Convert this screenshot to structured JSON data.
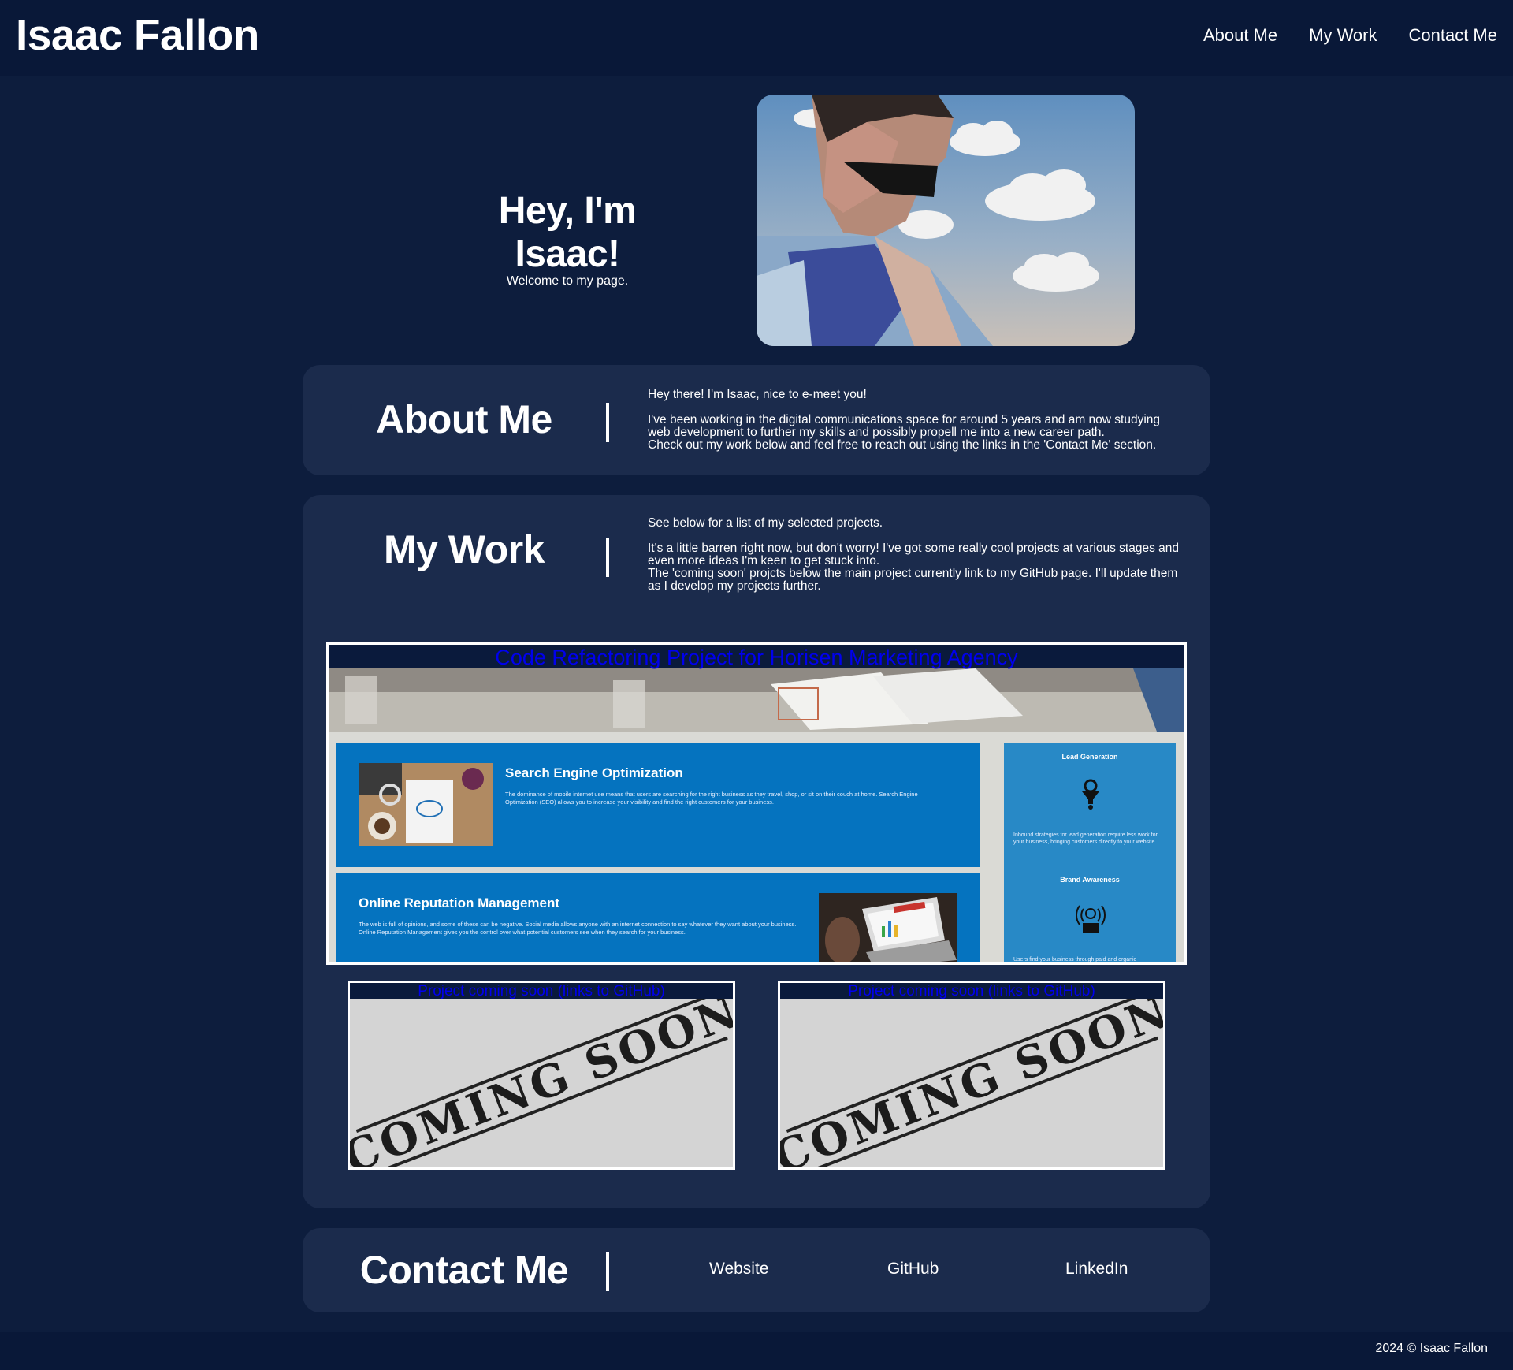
{
  "header": {
    "site_title": "Isaac Fallon",
    "nav": [
      "About Me",
      "My Work",
      "Contact Me"
    ]
  },
  "hero": {
    "heading": "Hey, I'm Isaac!",
    "subheading": "Welcome to my page."
  },
  "about": {
    "title": "About Me",
    "paragraphs": [
      "Hey there! I'm Isaac, nice to e-meet you!",
      "I've been working in the digital communications space for around 5 years and am now studying web development to further my skills and possibly propell me into a new career path.",
      "Check out my work below and feel free to reach out using the links in the 'Contact Me' section."
    ]
  },
  "work": {
    "title": "My Work",
    "paragraphs": [
      "See below for a list of my selected projects.",
      "It's a little barren right now, but don't worry! I've got some really cool projects at various stages and even more ideas I'm keen to get stuck into.",
      "The 'coming soon' projcts below the main project currently link to my GitHub page. I'll update them as I develop my projects further."
    ],
    "main_project": {
      "title": "Code Refactoring Project for Horisen Marketing Agency",
      "seo": {
        "heading": "Search Engine Optimization",
        "desc": "The dominance of mobile internet use means that users are searching for the right business as they travel, shop, or sit on their couch at home. Search Engine Optimization (SEO) allows you to increase your visibility and find the right customers for your business."
      },
      "orm": {
        "heading": "Online Reputation Management",
        "desc": "The web is full of opinions, and some of these can be negative. Social media allows anyone with an internet connection to say whatever they want about your business. Online Reputation Management gives you the control over what potential customers see when they search for your business."
      },
      "side": {
        "lead_heading": "Lead Generation",
        "lead_desc": "Inbound strategies for lead generation require less work for your business, bringing customers directly to your website.",
        "brand_heading": "Brand Awareness",
        "brand_desc": "Users find your business through paid and organic"
      }
    },
    "coming_soon": [
      {
        "title": "Project coming soon (links to GitHub)",
        "stamp": "COMING SOON"
      },
      {
        "title": "Project coming soon (links to GitHub)",
        "stamp": "COMING SOON"
      }
    ]
  },
  "contact": {
    "title": "Contact Me",
    "links": [
      "Website",
      "GitHub",
      "LinkedIn"
    ]
  },
  "footer": {
    "text": "2024 © Isaac Fallon"
  },
  "colors": {
    "page_bg": "#0d1d3d",
    "header_bg": "#091838",
    "card_bg": "#1b2b4c",
    "service_blue": "#0573bf",
    "side_blue": "#2889c6"
  }
}
